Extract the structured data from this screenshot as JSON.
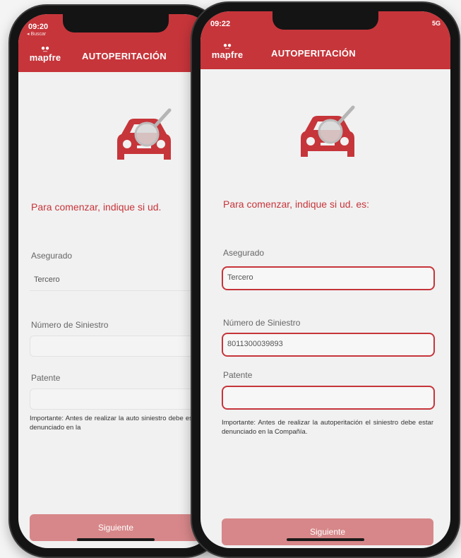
{
  "theme": {
    "brand_color": "#c6353a",
    "button_color": "#d78789"
  },
  "phone_back": {
    "status": {
      "time": "09:20",
      "back_label": "◂ Buscar"
    },
    "app": {
      "logo": "mapfre",
      "title": "AUTOPERITACIÓN"
    },
    "prompt": "Para comenzar, indique si ud.",
    "fields": {
      "insured_label": "Asegurado",
      "third_party_value": "Tercero",
      "claim_label": "Número de Siniestro",
      "claim_value": "",
      "plate_label": "Patente",
      "plate_value": ""
    },
    "note": "Importante: Antes de realizar la auto siniestro debe estar denunciado en la",
    "button": "Siguiente"
  },
  "phone_front": {
    "status": {
      "time": "09:22",
      "signal": "5G"
    },
    "app": {
      "logo": "mapfre",
      "title": "AUTOPERITACIÓN"
    },
    "prompt": "Para comenzar, indique si ud. es:",
    "fields": {
      "insured_label": "Asegurado",
      "third_party_value": "Tercero",
      "claim_label": "Número de Siniestro",
      "claim_value": "8011300039893",
      "plate_label": "Patente",
      "plate_value": ""
    },
    "note": "Importante: Antes de realizar la autoperitación el siniestro debe estar denunciado en la Compañía.",
    "button": "Siguiente"
  }
}
